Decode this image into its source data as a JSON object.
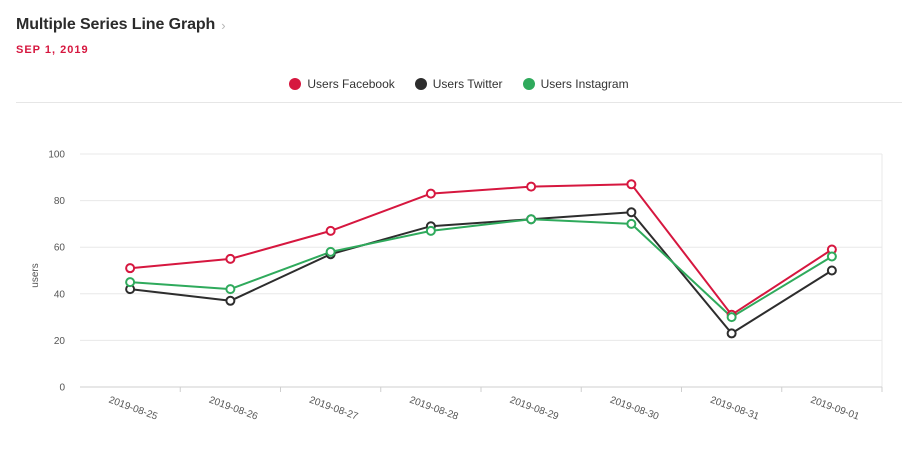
{
  "header": {
    "title": "Multiple Series Line Graph",
    "chevron": "›",
    "date": "SEP 1, 2019"
  },
  "chart_data": {
    "type": "line",
    "ylabel": "users",
    "ylim": [
      0,
      100
    ],
    "yticks": [
      0,
      20,
      40,
      60,
      80,
      100
    ],
    "grid": true,
    "legend_position": "top-center",
    "x": [
      "2019-08-25",
      "2019-08-26",
      "2019-08-27",
      "2019-08-28",
      "2019-08-29",
      "2019-08-30",
      "2019-08-31",
      "2019-09-01"
    ],
    "series": [
      {
        "name": "Users Facebook",
        "color": "#d6173f",
        "values": [
          51,
          55,
          67,
          83,
          86,
          87,
          31,
          59
        ]
      },
      {
        "name": "Users Twitter",
        "color": "#2d2d2d",
        "values": [
          42,
          37,
          57,
          69,
          72,
          75,
          23,
          50
        ]
      },
      {
        "name": "Users Instagram",
        "color": "#2faa5c",
        "values": [
          45,
          42,
          58,
          67,
          72,
          70,
          30,
          56
        ]
      }
    ]
  }
}
